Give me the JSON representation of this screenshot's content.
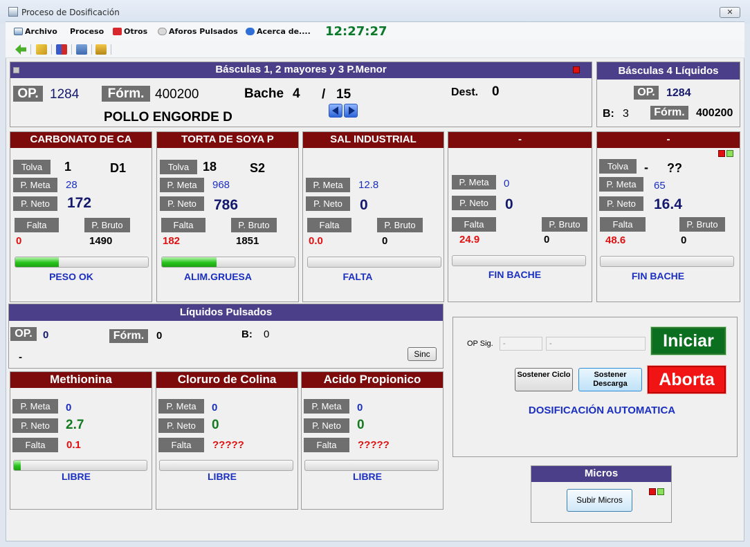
{
  "window": {
    "title": "Proceso de Dosificación",
    "close": "✕"
  },
  "menu": {
    "archivo": "Archivo",
    "proceso": "Proceso",
    "otros": "Otros",
    "aforos": "Aforos Pulsados",
    "acerca": "Acerca de....",
    "clock": "12:27:27"
  },
  "colors": {
    "header_blue": "#4b3f8a",
    "header_red": "#7d0b0b",
    "label_gray": "#6f6f6f",
    "value_blue": "#1a2fbf",
    "value_red": "#e01010",
    "value_green": "#137a1f",
    "clock_green": "#0a7a2a",
    "indicator_red": "#e01010",
    "indicator_green": "#8ee05a"
  },
  "basculas_main": {
    "title": "Básculas 1, 2 mayores y 3 P.Menor",
    "op_label": "OP.",
    "op_value": "1284",
    "form_label": "Fórm.",
    "form_value": "400200",
    "bache_label": "Bache",
    "bache_num": "4",
    "bache_sep": "/",
    "bache_total": "15",
    "dest_label": "Dest.",
    "dest_value": "0",
    "product": "POLLO ENGORDE D"
  },
  "basculas_liq": {
    "title": "Básculas 4 Líquidos",
    "op_label": "OP.",
    "op_value": "1284",
    "b_label": "B:",
    "b_value": "3",
    "form_label": "Fórm.",
    "form_value": "400200"
  },
  "labels": {
    "tolva": "Tolva",
    "p_meta": "P. Meta",
    "p_neto": "P. Neto",
    "falta": "Falta",
    "p_bruto": "P. Bruto"
  },
  "bins": [
    {
      "name": "CARBONATO DE CA",
      "tolva": "1",
      "code": "D1",
      "p_meta": "28",
      "p_neto": "172",
      "falta": "0",
      "p_bruto": "1490",
      "progress": 0.33,
      "status": "PESO OK"
    },
    {
      "name": "TORTA DE SOYA P",
      "tolva": "18",
      "code": "S2",
      "p_meta": "968",
      "p_neto": "786",
      "falta": "182",
      "p_bruto": "1851",
      "progress": 0.41,
      "status": "ALIM.GRUESA"
    },
    {
      "name": "SAL INDUSTRIAL",
      "p_meta": "12.8",
      "p_neto": "0",
      "falta": "0.0",
      "p_bruto": "0",
      "progress": 0,
      "status": "FALTA"
    },
    {
      "name": "-",
      "p_meta": "0",
      "p_neto": "0",
      "falta": "24.9",
      "p_bruto": "0",
      "progress": 0,
      "status": "FIN BACHE"
    },
    {
      "name": "-",
      "tolva": "-",
      "code": "??",
      "p_meta": "65",
      "p_neto": "16.4",
      "falta": "48.6",
      "p_bruto": "0",
      "progress": 0,
      "status": "FIN BACHE"
    }
  ],
  "liquidos": {
    "title": "Líquidos Pulsados",
    "op_label": "OP.",
    "op_value": "0",
    "form_label": "Fórm.",
    "form_value": "0",
    "b_label": "B:",
    "b_value": "0",
    "dash": "-",
    "sinc": "Sinc"
  },
  "liq_items": [
    {
      "name": "Methionina",
      "p_meta": "0",
      "p_neto": "2.7",
      "falta": "0.1",
      "progress": 0.05,
      "status": "LIBRE"
    },
    {
      "name": "Cloruro de Colina",
      "p_meta": "0",
      "p_neto": "0",
      "falta": "?????",
      "progress": 0,
      "status": "LIBRE"
    },
    {
      "name": "Acido Propionico",
      "p_meta": "0",
      "p_neto": "0",
      "falta": "?????",
      "progress": 0,
      "status": "LIBRE"
    }
  ],
  "control": {
    "op_sig_label": "OP Sig.",
    "op_sig_value1": "-",
    "op_sig_value2": "-",
    "iniciar": "Iniciar",
    "sostener_ciclo": "Sostener Ciclo",
    "sostener_descarga": "Sostener Descarga",
    "aborta": "Aborta",
    "mode": "DOSIFICACIÓN AUTOMATICA"
  },
  "micros": {
    "title": "Micros",
    "button": "Subir Micros"
  }
}
